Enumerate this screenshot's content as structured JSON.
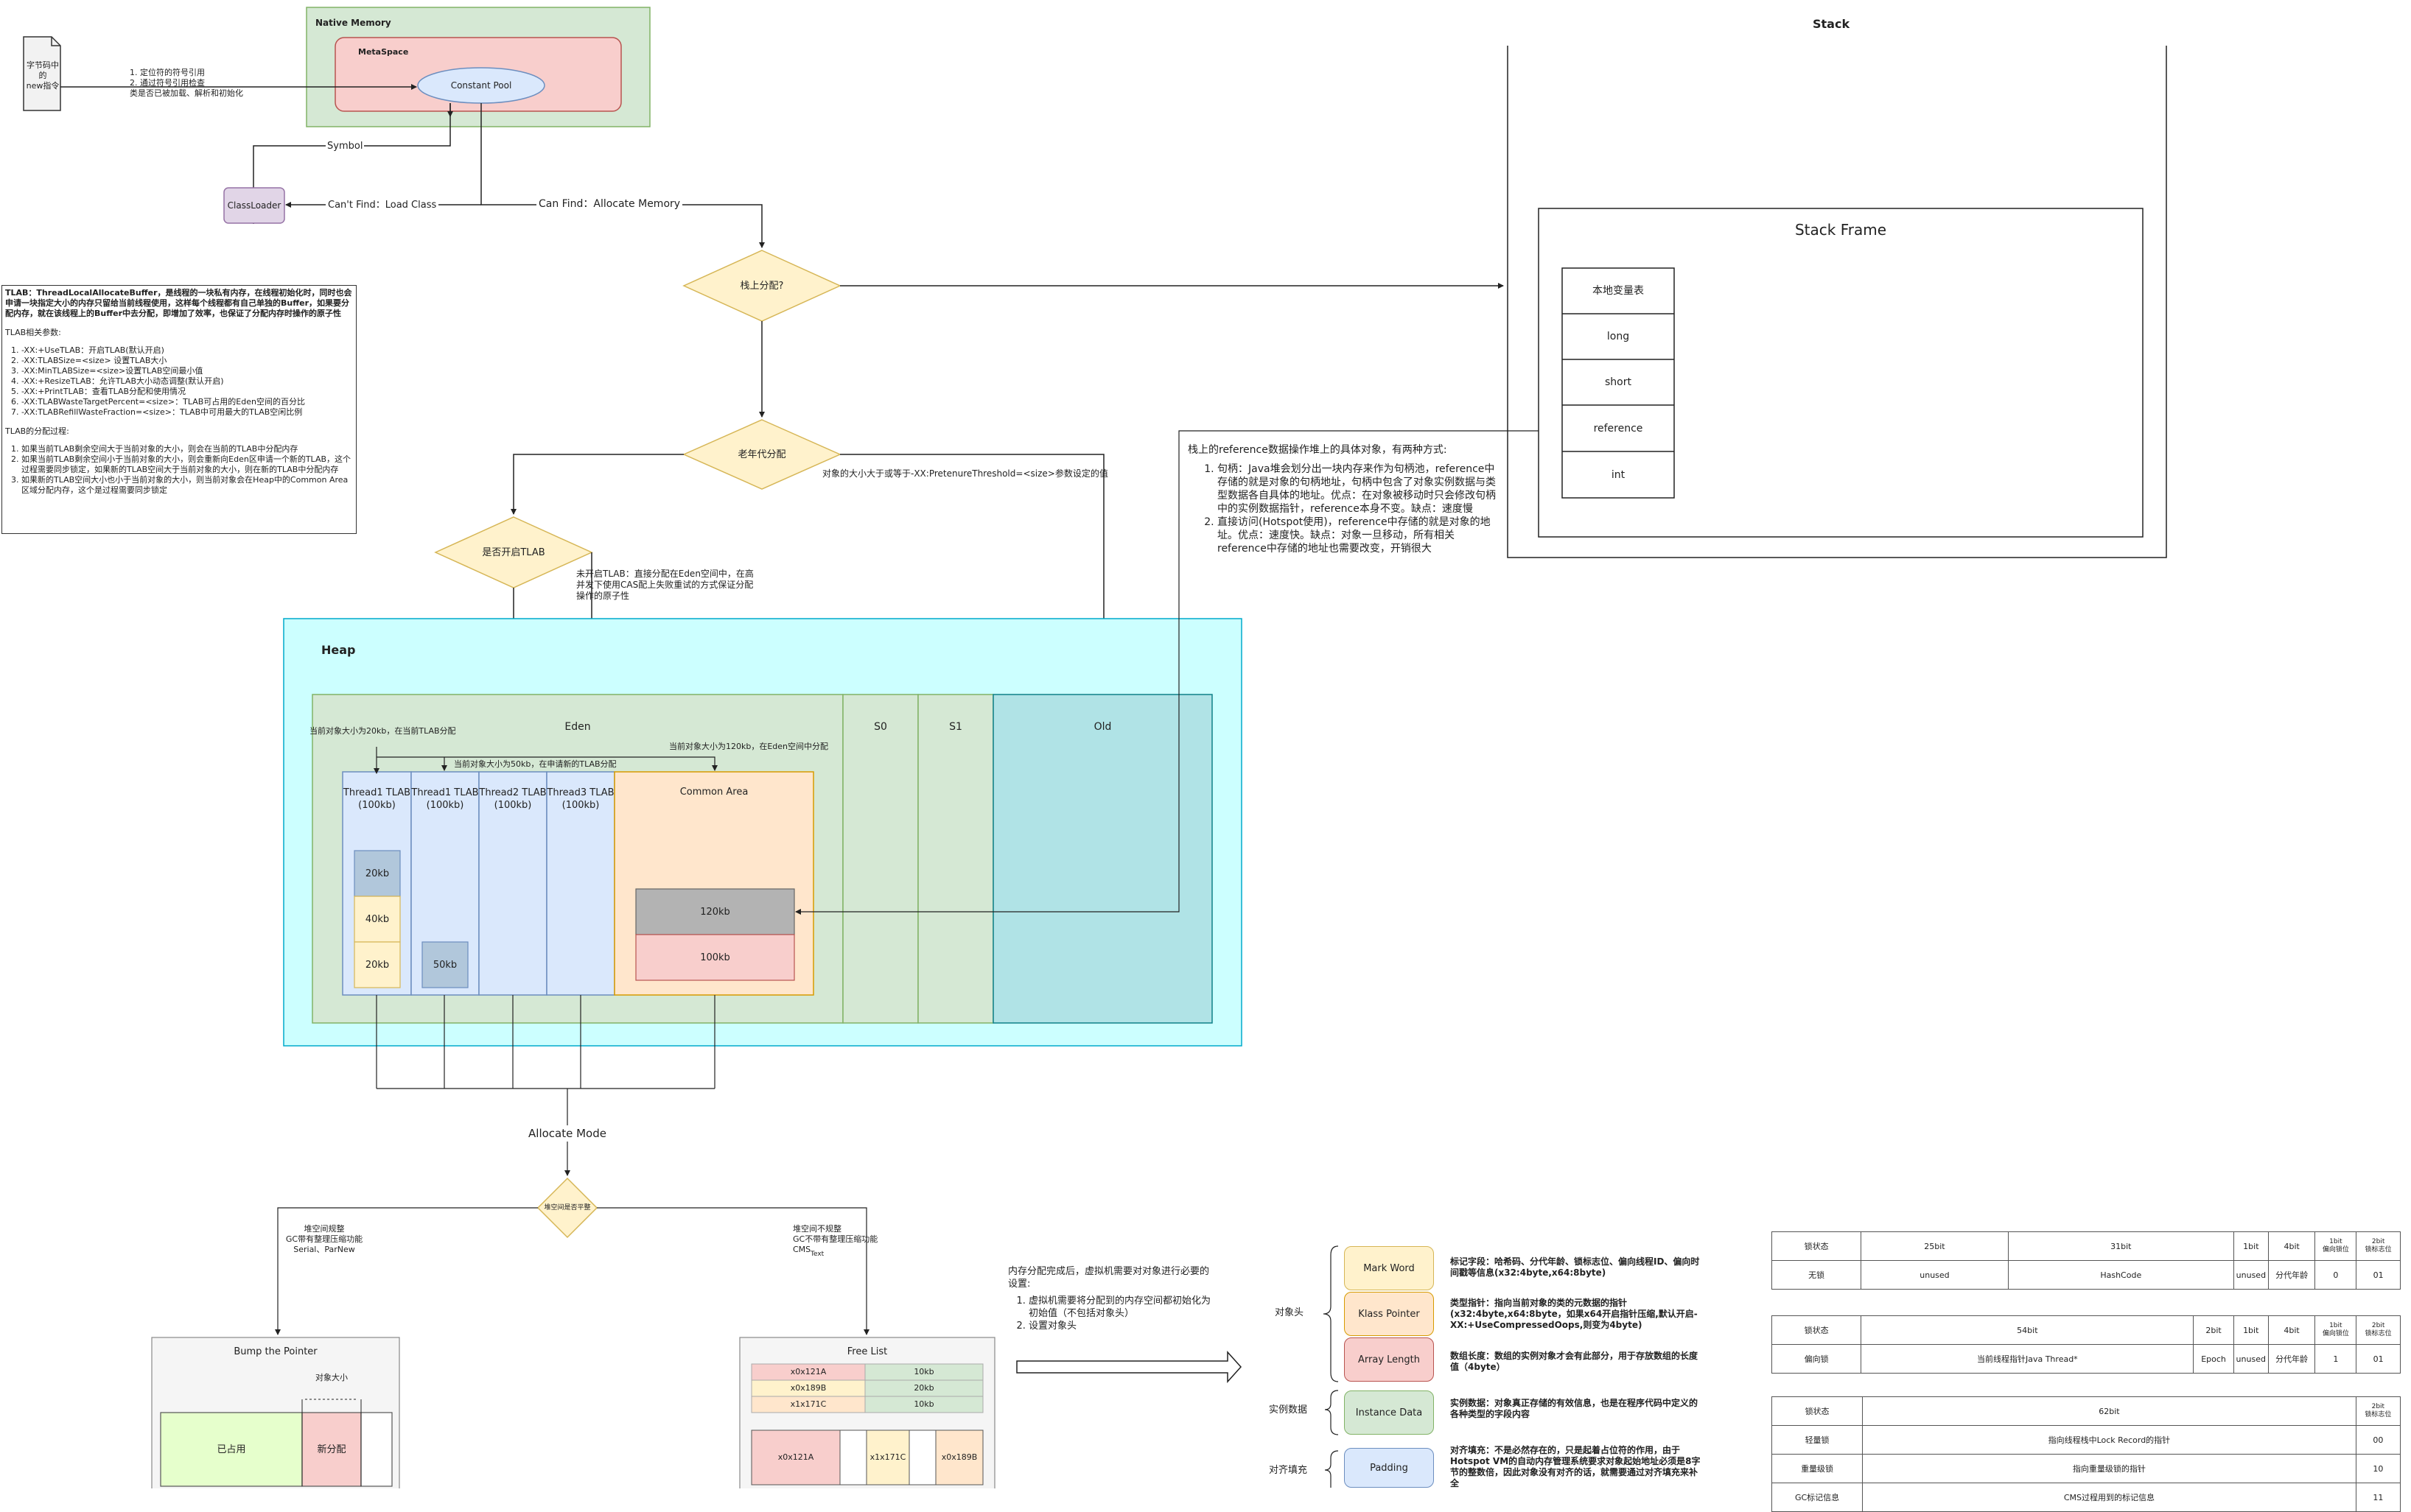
{
  "top": {
    "bytecode_note": "字节码中的\nnew指令",
    "steps_note": "1. 定位符的符号引用\n2. 通过符号引用检查\n类是否已被加载、解析和初始化",
    "native_memory": "Native Memory",
    "metaspace": "MetaSpace",
    "constant_pool": "Constant Pool",
    "symbol": "Symbol",
    "classloader": "ClassLoader",
    "cant_find": "Can't Find：Load Class",
    "can_find": "Can Find：Allocate Memory"
  },
  "tlab_note": {
    "intro": "TLAB：ThreadLocalAllocateBuffer，是线程的一块私有内存，在线程初始化时，同时也会申请一块指定大小的内存只留给当前线程使用，这样每个线程都有自己单独的Buffer，如果要分配内存，就在该线程上的Buffer中去分配，即增加了效率，也保证了分配内存时操作的原子性",
    "params_title": "TLAB相关参数:",
    "params": [
      "-XX:+UseTLAB：开启TLAB(默认开启)",
      "-XX:TLABSize=<size> 设置TLAB大小",
      "-XX:MinTLABSize=<size>设置TLAB空间最小值",
      "-XX:+ResizeTLAB：允许TLAB大小动态调整(默认开启)",
      "-XX:+PrintTLAB：查看TLAB分配和使用情况",
      "-XX:TLABWasteTargetPercent=<size>：TLAB可占用的Eden空间的百分比",
      "-XX:TLABRefillWasteFraction=<size>：TLAB中可用最大的TLAB空闲比例"
    ],
    "process_title": "TLAB的分配过程:",
    "process": [
      "如果当前TLAB剩余空间大于当前对象的大小，则会在当前的TLAB中分配内存",
      "如果当前TLAB剩余空间小于当前对象的大小，则会重新向Eden区申请一个新的TLAB，这个过程需要同步锁定，如果新的TLAB空间大于当前对象的大小，则在新的TLAB中分配内存",
      "如果新的TLAB空间大小也小于当前对象的大小，则当前对象会在Heap中的Common Area区域分配内存，这个是过程需要同步锁定"
    ]
  },
  "flow": {
    "stack_alloc": "栈上分配?",
    "old_alloc": "老年代分配",
    "old_cond": "对象的大小大于或等于-XX:PretenureThreshold=<size>参数设定的值",
    "tlab_open": "是否开启TLAB",
    "no_tlab_note": "未开启TLAB：直接分配在Eden空间中，在高并发下使用CAS配上失败重试的方式保证分配操作的原子性"
  },
  "stack": {
    "title": "Stack",
    "frame_title": "Stack Frame",
    "locals": [
      "本地变量表",
      "long",
      "short",
      "reference",
      "int"
    ],
    "ref_note_title": "栈上的reference数据操作堆上的具体对象，有两种方式:",
    "ref_note_items": [
      "句柄：Java堆会划分出一块内存来作为句柄池，reference中存储的就是对象的句柄地址，句柄中包含了对象实例数据与类型数据各自具体的地址。优点：在对象被移动时只会修改句柄中的实例数据指针，reference本身不变。缺点：速度慢",
      "直接访问(Hotspot使用)，reference中存储的就是对象的地址。优点：速度快。缺点：对象一旦移动，所有相关reference中存储的地址也需要改变，开销很大"
    ]
  },
  "heap": {
    "title": "Heap",
    "eden": "Eden",
    "s0": "S0",
    "s1": "S1",
    "old": "Old",
    "tlabs": [
      "Thread1\nTLAB\n(100kb)",
      "Thread1\nTLAB\n(100kb)",
      "Thread2\nTLAB\n(100kb)",
      "Thread3\nTLAB\n(100kb)"
    ],
    "common_area": "Common Area",
    "blocks": {
      "b20a": "20kb",
      "b40": "40kb",
      "b20b": "20kb",
      "b50": "50kb",
      "b120": "120kb",
      "b100": "100kb"
    },
    "note_20kb": "当前对象大小为20kb，在当前TLAB分配",
    "note_50kb": "当前对象大小为50kb，在申请新的TLAB分配",
    "note_120kb": "当前对象大小为120kb，在Eden空间中分配"
  },
  "alloc": {
    "mode": "Allocate Mode",
    "decision": "堆空间是否平整",
    "left_note": "堆空间规整\nGC带有整理压缩功能\nSerial、ParNew",
    "right_note": "堆空间不规整\nGC不带有整理压缩功能\nCMS",
    "right_note_sub": "Text",
    "bump_title": "Bump the Pointer",
    "obj_size": "对象大小",
    "used": "已占用",
    "new_alloc": "新分配",
    "free_title": "Free List",
    "free_rows": [
      {
        "addr": "x0x121A",
        "size": "10kb"
      },
      {
        "addr": "x0x189B",
        "size": "20kb"
      },
      {
        "addr": "x1x171C",
        "size": "10kb"
      }
    ],
    "free_cells": [
      "x0x121A",
      "x1x171C",
      "x0x189B"
    ]
  },
  "init_note": {
    "title": "内存分配完成后，虚拟机需要对对象进行必要的设置:",
    "items": [
      "虚拟机需要将分配到的内存空间都初始化为初始值（不包括对象头）",
      "设置对象头"
    ]
  },
  "object_layout": {
    "header_label": "对象头",
    "instance_label": "实例数据",
    "padding_label": "对齐填充",
    "mark_word": "Mark Word",
    "klass_pointer": "Klass Pointer",
    "array_length": "Array Length",
    "instance_data": "Instance Data",
    "padding": "Padding",
    "mark_word_desc": "标记字段：哈希码、分代年龄、锁标志位、偏向线程ID、偏向时间戳等信息(x32:4byte,x64:8byte)",
    "klass_desc": "类型指针：指向当前对象的类的元数据的指针(x32:4byte,x64:8byte，如果x64开启指针压缩,默认开启-XX:+UseCompressedOops,则变为4byte)",
    "array_desc": "数组长度：数组的实例对象才会有此部分，用于存放数组的长度值（4byte）",
    "instance_desc": "实例数据：对象真正存储的有效信息，也是在程序代码中定义的各种类型的字段内容",
    "padding_desc": "对齐填充：不是必然存在的，只是起着占位符的作用，由于Hotspot VM的自动内存管理系统要求对象起始地址必须是8字节的整数倍，因此对象没有对齐的话，就需要通过对齐填充来补全"
  },
  "mark_tables": {
    "t1": {
      "header": [
        "锁状态",
        "25bit",
        "31bit",
        "1bit",
        "4bit",
        "1bit\n偏向锁位",
        "2bit\n锁标志位"
      ],
      "row": [
        "无锁",
        "unused",
        "HashCode",
        "unused",
        "分代年龄",
        "0",
        "01"
      ]
    },
    "t2": {
      "header": [
        "锁状态",
        "54bit",
        "2bit",
        "1bit",
        "4bit",
        "1bit\n偏向锁位",
        "2bit\n锁标志位"
      ],
      "row": [
        "偏向锁",
        "当前线程指针Java Thread*",
        "Epoch",
        "unused",
        "分代年龄",
        "1",
        "01"
      ]
    },
    "t3": {
      "header": [
        "锁状态",
        "62bit",
        "2bit\n锁标志位"
      ],
      "rows": [
        [
          "轻量锁",
          "指向线程栈中Lock Record的指针",
          "00"
        ],
        [
          "重量级锁",
          "指向重量级锁的指针",
          "10"
        ],
        [
          "GC标记信息",
          "CMS过程用到的标记信息",
          "11"
        ]
      ]
    }
  }
}
